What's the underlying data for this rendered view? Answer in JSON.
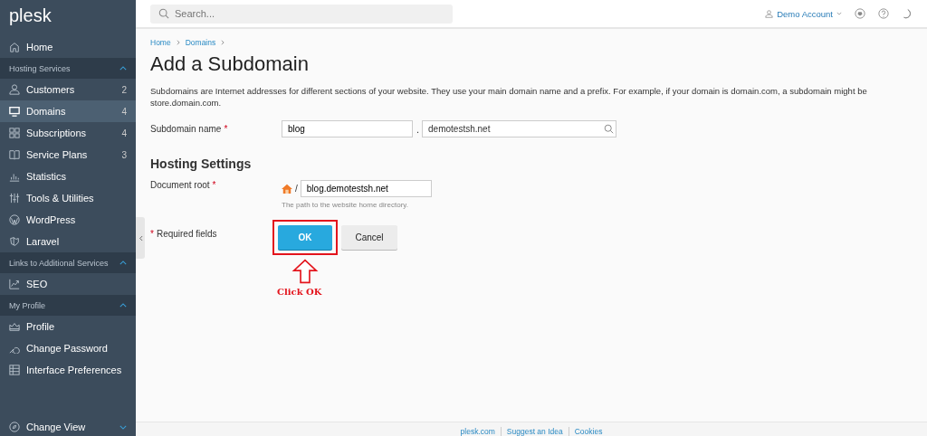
{
  "sidebar": {
    "logo": "plesk",
    "items": [
      {
        "kind": "item",
        "label": "Home",
        "selected": false
      },
      {
        "kind": "section",
        "label": "Hosting Services",
        "expanded": true
      },
      {
        "kind": "item",
        "label": "Customers",
        "count": "2",
        "selected": false
      },
      {
        "kind": "item",
        "label": "Domains",
        "count": "4",
        "selected": true
      },
      {
        "kind": "item",
        "label": "Subscriptions",
        "count": "4",
        "selected": false
      },
      {
        "kind": "item",
        "label": "Service Plans",
        "count": "3",
        "selected": false
      },
      {
        "kind": "item",
        "label": "Statistics",
        "selected": false
      },
      {
        "kind": "item",
        "label": "Tools & Utilities",
        "selected": false
      },
      {
        "kind": "item",
        "label": "WordPress",
        "selected": false
      },
      {
        "kind": "item",
        "label": "Laravel",
        "selected": false
      },
      {
        "kind": "section",
        "label": "Links to Additional Services",
        "expanded": true
      },
      {
        "kind": "item",
        "label": "SEO",
        "selected": false
      },
      {
        "kind": "section",
        "label": "My Profile",
        "expanded": true
      },
      {
        "kind": "item",
        "label": "Profile",
        "selected": false
      },
      {
        "kind": "item",
        "label": "Change Password",
        "selected": false
      },
      {
        "kind": "item",
        "label": "Interface Preferences",
        "selected": false
      }
    ],
    "footer": {
      "label": "Change View",
      "expanded": false
    }
  },
  "topbar": {
    "search": {
      "placeholder": "Search..."
    },
    "account": "Demo Account"
  },
  "breadcrumbs": [
    "Home",
    "Domains"
  ],
  "title": "Add a Subdomain",
  "description": "Subdomains are Internet addresses for different sections of your website. They use your main domain name and a prefix. For example, if your domain is domain.com, a subdomain might be store.domain.com.",
  "subdomain": {
    "label": "Subdomain name",
    "required_mark": "*",
    "prefix": "blog",
    "separator": ".",
    "domain": "demotestsh.net"
  },
  "hosting": {
    "heading": "Hosting Settings",
    "label": "Document root",
    "required_mark": "*",
    "separator": "/",
    "value": "blog.demotestsh.net",
    "hint": "The path to the website home directory."
  },
  "required_note": {
    "mark": "*",
    "text": "Required fields"
  },
  "buttons": [
    {
      "label": "OK",
      "kind": "primary"
    },
    {
      "label": "Cancel",
      "kind": "secondary"
    }
  ],
  "annotation": {
    "text": "Click OK"
  },
  "footer_links": [
    "plesk.com",
    "Suggest an Idea",
    "Cookies"
  ]
}
